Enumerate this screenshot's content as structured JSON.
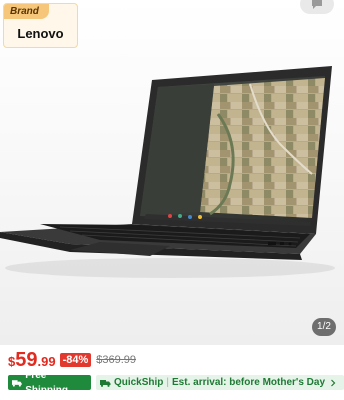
{
  "brand": {
    "tag": "Brand",
    "name": "Lenovo"
  },
  "gallery": {
    "counter": "1/2",
    "share_icon": "chat-bubble-icon"
  },
  "price": {
    "currency": "$",
    "integer": "59",
    "decimal": ".99",
    "discount": "-84%",
    "original": "$369.99",
    "color": "#e22a1f"
  },
  "shipping": {
    "free_label": "Free Shipping",
    "quickship_label": "QuickShip",
    "arrival_text": "Est. arrival: before Mother's Day",
    "accent": "#1f8a3b"
  }
}
